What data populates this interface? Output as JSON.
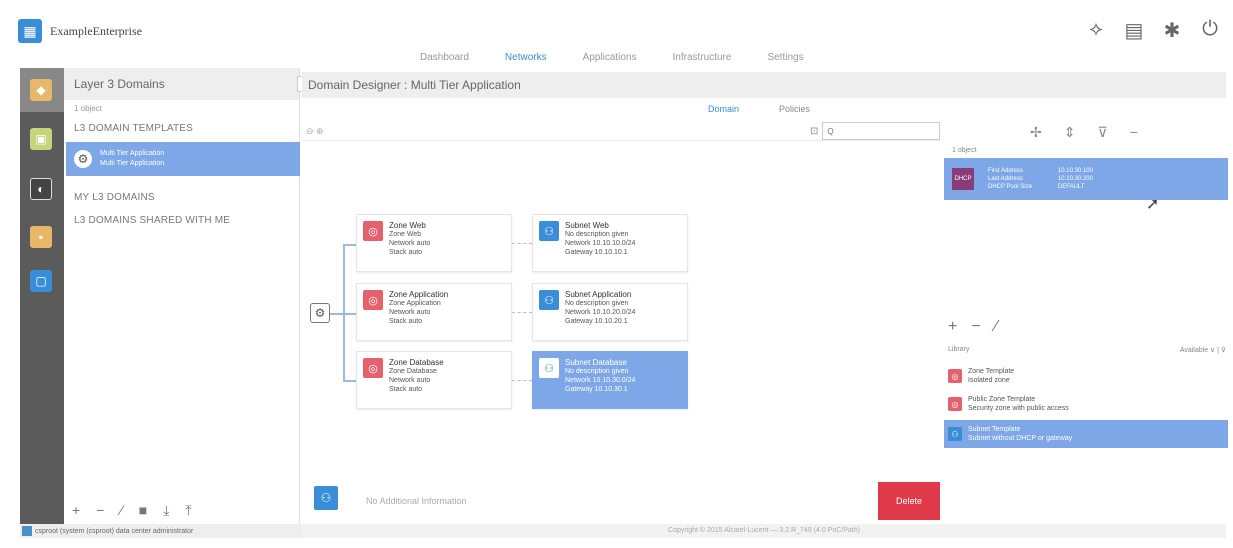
{
  "app": {
    "title": "ExampleEnterprise"
  },
  "top_icons": [
    {
      "name": "pulse-icon",
      "glyph": "⟡"
    },
    {
      "name": "database-icon",
      "glyph": "▤"
    },
    {
      "name": "puzzle-icon",
      "glyph": "✱"
    },
    {
      "name": "power-icon",
      "glyph": "⏻"
    }
  ],
  "nav_tabs": [
    "Dashboard",
    "Networks",
    "Applications",
    "Infrastructure",
    "Settings"
  ],
  "nav_active": "Networks",
  "left_panel": {
    "title": "Layer 3 Domains",
    "count": "1 object",
    "section_templates": "L3 DOMAIN TEMPLATES",
    "selected_item_line1": "Multi Tier Application",
    "selected_item_line2": "Multi Tier Application",
    "section_my": "MY L3 DOMAINS",
    "section_shared": "L3 DOMAINS SHARED WITH ME",
    "collapse_glyph": "‹"
  },
  "status_strip": "csproot (system (csproot)    data center administrator",
  "copyright": "Copyright © 2015 Alcatel-Lucent — 3.2.R_749 (4.0 PoC/Path)",
  "designer": {
    "title": "Domain Designer : Multi Tier Application",
    "view_tabs": [
      "Domain",
      "Policies"
    ],
    "view_active": "Domain",
    "zoom_label": "⊖ ⊕",
    "search_placeholder": "Q"
  },
  "zones": [
    {
      "title": "Zone Web",
      "sub": "Zone Web",
      "l3": "Network  auto",
      "l4": "Stack    auto"
    },
    {
      "title": "Zone Application",
      "sub": "Zone Application",
      "l3": "Network  auto",
      "l4": "Stack    auto"
    },
    {
      "title": "Zone Database",
      "sub": "Zone Database",
      "l3": "Network  auto",
      "l4": "Stack    auto"
    }
  ],
  "subnets": [
    {
      "title": "Subnet Web",
      "sub": "No description given",
      "l3": "Network  10.10.10.0/24",
      "l4": "Gateway  10.10.10.1"
    },
    {
      "title": "Subnet Application",
      "sub": "No description given",
      "l3": "Network  10.10.20.0/24",
      "l4": "Gateway  10.10.20.1"
    },
    {
      "title": "Subnet Database",
      "sub": "No description given",
      "l3": "Network  10.10.30.0/24",
      "l4": "Gateway  10.10.30.1"
    }
  ],
  "right_panel": {
    "count": "1 object",
    "selected": {
      "badge": "DHCP",
      "labels": [
        "First Address",
        "Last Address",
        "DHCP Pool Size"
      ],
      "values": [
        "10.10.30.100",
        "10.10.30.200",
        "DEFAULT"
      ]
    },
    "library_label": "Library",
    "library_filter": "Available ∨  | ⊽",
    "library_items": [
      {
        "title": "Zone Template",
        "sub": "Isolated zone"
      },
      {
        "title": "Public Zone Template",
        "sub": "Security zone with public access"
      },
      {
        "title": "Subnet Template",
        "sub": "Subnet without DHCP or gateway"
      }
    ]
  },
  "bottom": {
    "info_text": "No Additional Information",
    "delete_label": "Delete"
  },
  "colors": {
    "accent": "#3a8ed8",
    "selection": "#7da7e6",
    "zone_red": "#e5616c",
    "delete_red": "#e03a4a",
    "rail": "#5b5b5b"
  }
}
